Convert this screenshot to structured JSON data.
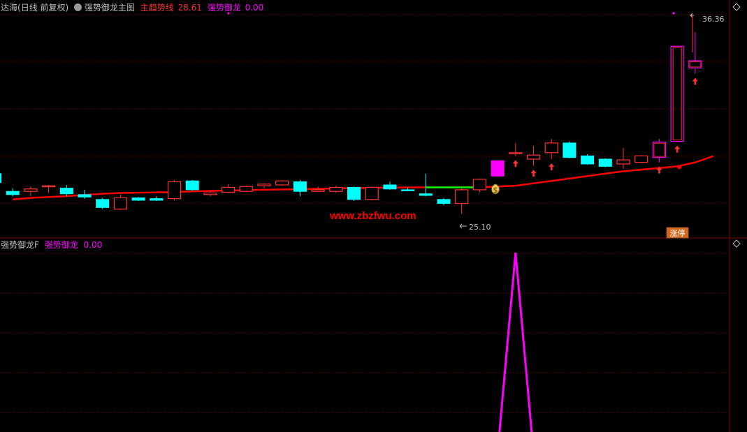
{
  "main_header": {
    "stock_name": "达海",
    "period": "(日线 前复权)",
    "indicator_name": "强势御龙主图",
    "trend_label": "主趋势线",
    "trend_value": "28.61",
    "signal_label": "强势御龙",
    "signal_value": "0.00"
  },
  "sub_header": {
    "indicator_name": "强势御龙F",
    "signal_label": "强势御龙",
    "signal_value": "0.00"
  },
  "annotations": {
    "high_price": "36.36",
    "low_price": "25.10",
    "watermark": "www.zbzfwu.com",
    "limit_up_tag": "涨停",
    "money_bag_glyph": "$"
  },
  "colors": {
    "up": "#ff3232",
    "down": "#00ffff",
    "trend": "#ff0000",
    "signal": "#ff00ff",
    "trend_green": "#00ff00",
    "grid": "#800000",
    "text_white": "#c0c0c0"
  },
  "chart_data": [
    {
      "type": "candlestick",
      "title": "强势御龙主图",
      "ylim": [
        24.0,
        37.5
      ],
      "candles": [
        {
          "o": 27.6,
          "h": 28.0,
          "l": 27.0,
          "c": 27.05
        },
        {
          "o": 26.5,
          "h": 26.7,
          "l": 26.2,
          "c": 26.3
        },
        {
          "o": 26.5,
          "h": 26.8,
          "l": 26.2,
          "c": 26.65
        },
        {
          "o": 26.8,
          "h": 26.9,
          "l": 26.4,
          "c": 26.85
        },
        {
          "o": 26.7,
          "h": 26.9,
          "l": 26.2,
          "c": 26.35
        },
        {
          "o": 26.3,
          "h": 26.6,
          "l": 26.05,
          "c": 26.15
        },
        {
          "o": 26.0,
          "h": 26.1,
          "l": 25.4,
          "c": 25.5
        },
        {
          "o": 25.4,
          "h": 26.3,
          "l": 25.35,
          "c": 26.1
        },
        {
          "o": 26.1,
          "h": 26.15,
          "l": 25.9,
          "c": 25.95
        },
        {
          "o": 26.05,
          "h": 26.2,
          "l": 25.9,
          "c": 25.95
        },
        {
          "o": 26.05,
          "h": 27.2,
          "l": 25.95,
          "c": 27.1
        },
        {
          "o": 27.15,
          "h": 27.2,
          "l": 26.55,
          "c": 26.6
        },
        {
          "o": 26.3,
          "h": 26.5,
          "l": 26.2,
          "c": 26.4
        },
        {
          "o": 26.45,
          "h": 26.95,
          "l": 26.4,
          "c": 26.75
        },
        {
          "o": 26.5,
          "h": 26.85,
          "l": 26.45,
          "c": 26.8
        },
        {
          "o": 26.85,
          "h": 27.0,
          "l": 26.7,
          "c": 26.95
        },
        {
          "o": 26.9,
          "h": 27.2,
          "l": 26.85,
          "c": 27.15
        },
        {
          "o": 27.1,
          "h": 27.2,
          "l": 26.2,
          "c": 26.5
        },
        {
          "o": 26.5,
          "h": 26.8,
          "l": 26.5,
          "c": 26.6
        },
        {
          "o": 26.5,
          "h": 26.85,
          "l": 26.4,
          "c": 26.75
        },
        {
          "o": 26.75,
          "h": 26.8,
          "l": 25.9,
          "c": 26.0
        },
        {
          "o": 26.0,
          "h": 26.8,
          "l": 25.95,
          "c": 26.75
        },
        {
          "o": 26.9,
          "h": 27.1,
          "l": 26.6,
          "c": 26.65
        },
        {
          "o": 26.6,
          "h": 26.75,
          "l": 26.5,
          "c": 26.55
        },
        {
          "o": 26.35,
          "h": 27.6,
          "l": 26.2,
          "c": 26.25
        },
        {
          "o": 26.0,
          "h": 26.1,
          "l": 25.65,
          "c": 25.75
        },
        {
          "o": 25.75,
          "h": 26.7,
          "l": 25.1,
          "c": 26.6
        },
        {
          "o": 26.6,
          "h": 27.3,
          "l": 26.45,
          "c": 27.25
        },
        {
          "o": 27.45,
          "h": 28.45,
          "l": 27.4,
          "c": 28.4
        },
        {
          "o": 28.9,
          "h": 29.5,
          "l": 28.7,
          "c": 28.9
        },
        {
          "o": 28.5,
          "h": 29.3,
          "l": 28.1,
          "c": 28.75
        },
        {
          "o": 28.9,
          "h": 29.75,
          "l": 28.5,
          "c": 29.5
        },
        {
          "o": 29.5,
          "h": 29.6,
          "l": 28.55,
          "c": 28.6
        },
        {
          "o": 28.7,
          "h": 28.8,
          "l": 28.15,
          "c": 28.2
        },
        {
          "o": 28.5,
          "h": 28.55,
          "l": 28.0,
          "c": 28.05
        },
        {
          "o": 28.2,
          "h": 29.2,
          "l": 27.9,
          "c": 28.45
        },
        {
          "o": 28.3,
          "h": 28.75,
          "l": 28.25,
          "c": 28.7
        },
        {
          "o": 28.6,
          "h": 29.75,
          "l": 28.3,
          "c": 29.55
        },
        {
          "o": 29.6,
          "h": 35.5,
          "l": 29.6,
          "c": 35.5
        },
        {
          "o": 34.15,
          "h": 36.36,
          "l": 33.8,
          "c": 34.6
        }
      ],
      "trend_line": [
        26.0,
        26.1,
        26.15,
        26.2,
        26.28,
        26.35,
        26.4,
        26.42,
        26.44,
        26.45,
        26.5,
        26.53,
        26.55,
        26.58,
        26.6,
        26.62,
        26.64,
        26.66,
        26.68,
        26.7,
        26.72,
        26.73,
        26.74,
        26.75,
        26.75,
        26.75,
        26.75,
        26.8,
        26.85,
        27.0,
        27.15,
        27.3,
        27.45,
        27.6,
        27.75,
        27.85,
        27.95,
        28.05,
        28.3,
        28.68
      ],
      "trend_green_from": 23,
      "trend_green_to": 26,
      "signal_candles": [
        28,
        37,
        38,
        39
      ],
      "up_arrow_candles": [
        29,
        30,
        31,
        37,
        38,
        39
      ]
    },
    {
      "type": "line",
      "title": "强势御龙F",
      "ylim": [
        0,
        1
      ],
      "values": [
        0,
        0,
        0,
        0,
        0,
        0,
        0,
        0,
        0,
        0,
        0,
        0,
        0,
        0,
        0,
        0,
        0,
        0,
        0,
        0,
        0,
        0,
        0,
        0,
        0,
        0,
        0,
        0,
        1,
        0,
        0,
        0,
        0,
        0,
        0,
        0,
        0,
        0,
        0,
        0
      ]
    }
  ]
}
